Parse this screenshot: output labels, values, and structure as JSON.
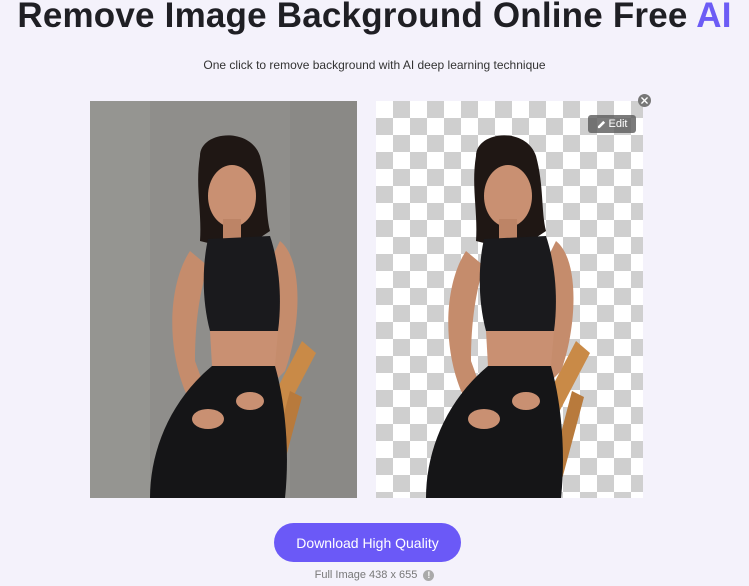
{
  "header": {
    "title_main": "Remove Image Background Online Free",
    "title_accent": "AI",
    "subtitle": "One click to remove background with AI deep learning technique"
  },
  "preview": {
    "edit_label": "Edit",
    "close_icon": "close-icon",
    "edit_icon": "pencil-icon"
  },
  "actions": {
    "download_label": "Download High Quality",
    "full_image_label": "Full Image 438 x 655",
    "info_icon": "info-icon"
  },
  "colors": {
    "accent": "#6c5cf5",
    "button": "#6b59f7",
    "background": "#f4f2fb"
  }
}
